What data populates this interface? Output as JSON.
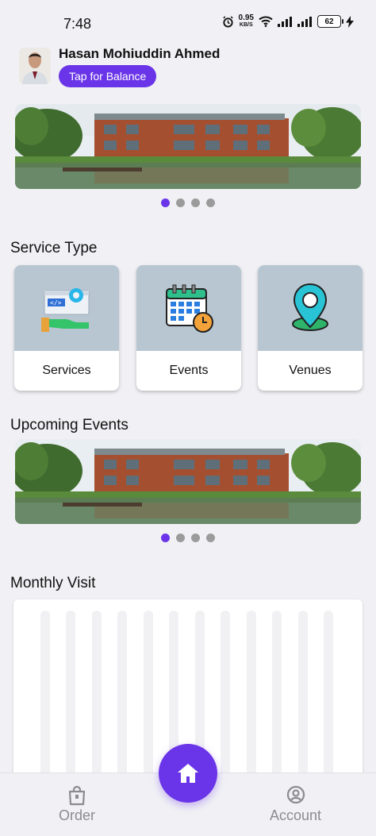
{
  "status_bar": {
    "time": "7:48",
    "net_speed_value": "0.95",
    "net_speed_unit": "KB/S",
    "battery": "62"
  },
  "profile": {
    "name": "Hasan Mohiuddin Ahmed",
    "balance_button": "Tap for Balance"
  },
  "sections": {
    "service_type": "Service Type",
    "upcoming_events": "Upcoming Events",
    "monthly_visit": "Monthly Visit"
  },
  "services": [
    {
      "label": "Services",
      "icon": "code-gear-hand-icon"
    },
    {
      "label": "Events",
      "icon": "calendar-clock-icon"
    },
    {
      "label": "Venues",
      "icon": "map-pin-icon"
    }
  ],
  "carousel": {
    "dot_count": 4,
    "active_index": 0
  },
  "bottom_nav": {
    "order": "Order",
    "account": "Account",
    "home_icon": "home-icon"
  },
  "colors": {
    "accent": "#6a35e8",
    "card_top": "#b8c6d2",
    "inactive_dot": "#9b9b9b",
    "nav_inactive": "#8c8c90"
  }
}
